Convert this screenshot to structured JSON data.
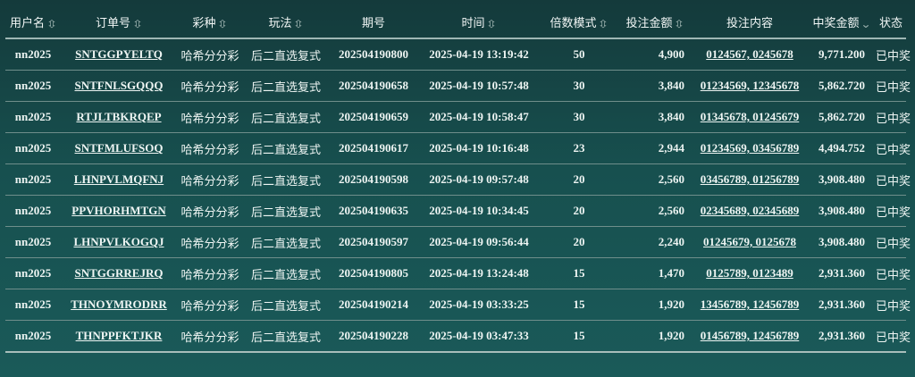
{
  "headers": [
    {
      "label": "用户名",
      "sortable": true,
      "sort_icon": "sort-updown-icon"
    },
    {
      "label": "订单号",
      "sortable": true,
      "sort_icon": "sort-updown-icon"
    },
    {
      "label": "彩种",
      "sortable": true,
      "sort_icon": "sort-updown-icon"
    },
    {
      "label": "玩法",
      "sortable": true,
      "sort_icon": "sort-updown-icon"
    },
    {
      "label": "期号",
      "sortable": false
    },
    {
      "label": "时间",
      "sortable": true,
      "sort_icon": "sort-updown-icon"
    },
    {
      "label": "倍数模式",
      "sortable": true,
      "sort_icon": "sort-updown-icon"
    },
    {
      "label": "投注金额",
      "sortable": true,
      "sort_icon": "sort-updown-icon"
    },
    {
      "label": "投注内容",
      "sortable": false
    },
    {
      "label": "中奖金额",
      "sortable": true,
      "sort_icon": "sort-down-icon"
    },
    {
      "label": "状态",
      "sortable": false
    }
  ],
  "rows": [
    {
      "user": "nn2025",
      "order": "SNTGGPYELTQ",
      "lottery": "哈希分分彩",
      "play": "后二直选复式",
      "period": "202504190800",
      "time": "2025-04-19 13:19:42",
      "multiple": "50",
      "bet": "4,900",
      "content": "0124567, 0245678",
      "prize": "9,771.200",
      "status": "已中奖"
    },
    {
      "user": "nn2025",
      "order": "SNTFNLSGQQQ",
      "lottery": "哈希分分彩",
      "play": "后二直选复式",
      "period": "202504190658",
      "time": "2025-04-19 10:57:48",
      "multiple": "30",
      "bet": "3,840",
      "content": "01234569, 12345678",
      "prize": "5,862.720",
      "status": "已中奖"
    },
    {
      "user": "nn2025",
      "order": "RTJLTBKRQEP",
      "lottery": "哈希分分彩",
      "play": "后二直选复式",
      "period": "202504190659",
      "time": "2025-04-19 10:58:47",
      "multiple": "30",
      "bet": "3,840",
      "content": "01345678, 01245679",
      "prize": "5,862.720",
      "status": "已中奖"
    },
    {
      "user": "nn2025",
      "order": "SNTFMLUFSOQ",
      "lottery": "哈希分分彩",
      "play": "后二直选复式",
      "period": "202504190617",
      "time": "2025-04-19 10:16:48",
      "multiple": "23",
      "bet": "2,944",
      "content": "01234569, 03456789",
      "prize": "4,494.752",
      "status": "已中奖"
    },
    {
      "user": "nn2025",
      "order": "LHNPVLMQFNJ",
      "lottery": "哈希分分彩",
      "play": "后二直选复式",
      "period": "202504190598",
      "time": "2025-04-19 09:57:48",
      "multiple": "20",
      "bet": "2,560",
      "content": "03456789, 01256789",
      "prize": "3,908.480",
      "status": "已中奖"
    },
    {
      "user": "nn2025",
      "order": "PPVHORHMTGN",
      "lottery": "哈希分分彩",
      "play": "后二直选复式",
      "period": "202504190635",
      "time": "2025-04-19 10:34:45",
      "multiple": "20",
      "bet": "2,560",
      "content": "02345689, 02345689",
      "prize": "3,908.480",
      "status": "已中奖"
    },
    {
      "user": "nn2025",
      "order": "LHNPVLKOGQJ",
      "lottery": "哈希分分彩",
      "play": "后二直选复式",
      "period": "202504190597",
      "time": "2025-04-19 09:56:44",
      "multiple": "20",
      "bet": "2,240",
      "content": "01245679, 0125678",
      "prize": "3,908.480",
      "status": "已中奖"
    },
    {
      "user": "nn2025",
      "order": "SNTGGRREJRQ",
      "lottery": "哈希分分彩",
      "play": "后二直选复式",
      "period": "202504190805",
      "time": "2025-04-19 13:24:48",
      "multiple": "15",
      "bet": "1,470",
      "content": "0125789, 0123489",
      "prize": "2,931.360",
      "status": "已中奖"
    },
    {
      "user": "nn2025",
      "order": "THNOYMRODRR",
      "lottery": "哈希分分彩",
      "play": "后二直选复式",
      "period": "202504190214",
      "time": "2025-04-19 03:33:25",
      "multiple": "15",
      "bet": "1,920",
      "content": "13456789, 12456789",
      "prize": "2,931.360",
      "status": "已中奖"
    },
    {
      "user": "nn2025",
      "order": "THNPPFKTJKR",
      "lottery": "哈希分分彩",
      "play": "后二直选复式",
      "period": "202504190228",
      "time": "2025-04-19 03:47:33",
      "multiple": "15",
      "bet": "1,920",
      "content": "01456789, 12456789",
      "prize": "2,931.360",
      "status": "已中奖"
    }
  ]
}
